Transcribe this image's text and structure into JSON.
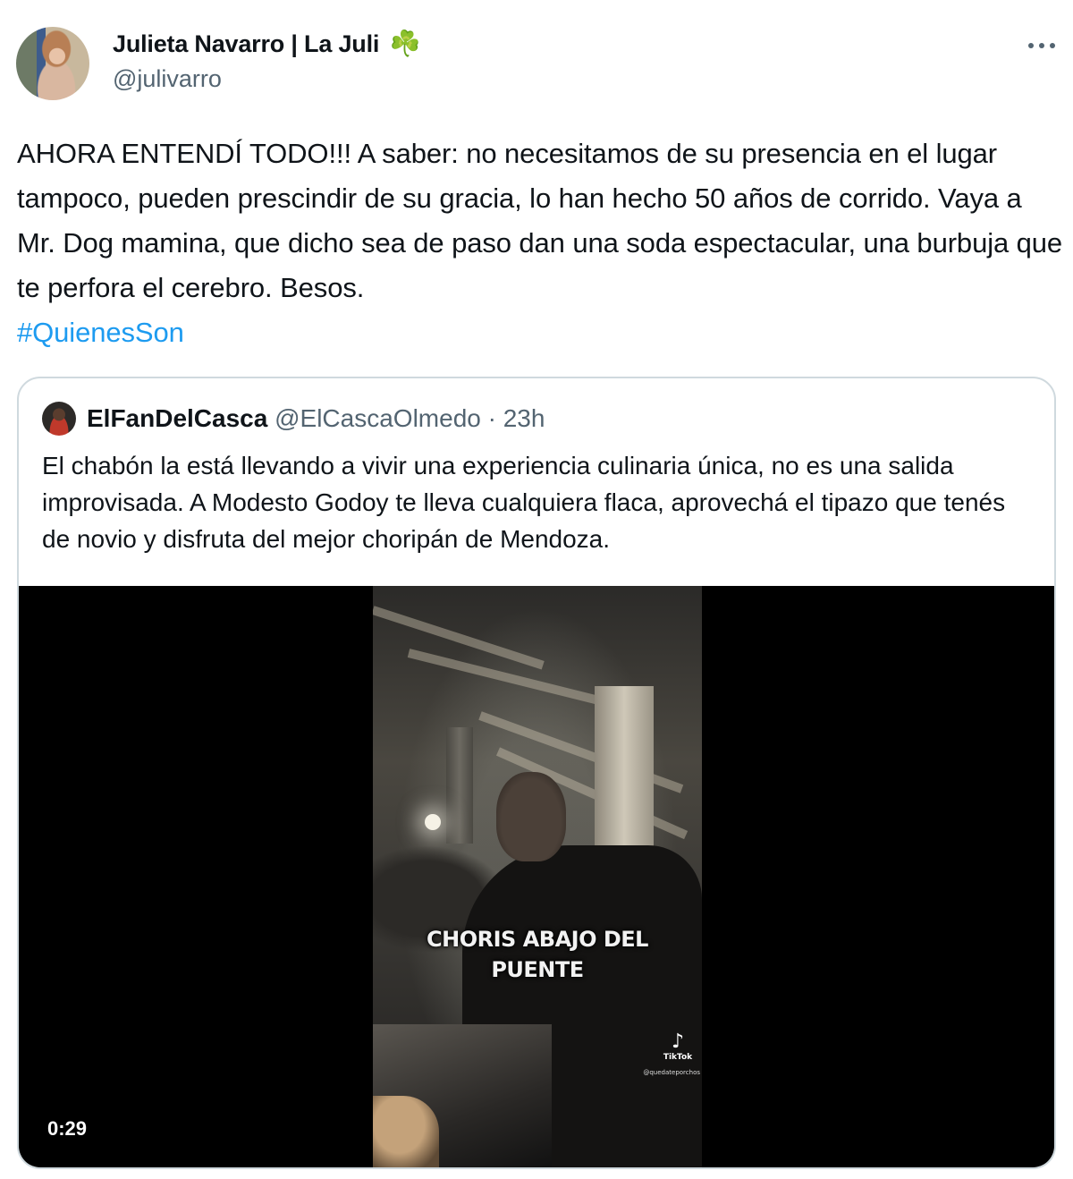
{
  "author": {
    "display_name": "Julieta Navarro | La Juli",
    "emoji": "☘️",
    "handle": "@julivarro"
  },
  "menu": {
    "icon": "more-horizontal-icon"
  },
  "tweet": {
    "text": "AHORA ENTENDÍ TODO!!! A saber: no necesitamos de su presencia en el lugar tampoco, pueden prescindir de su gracia, lo han hecho 50 años de corrido. Vaya a Mr. Dog mamina, que dicho sea de paso dan una soda espectacular, una burbuja que te perfora el cerebro. Besos.",
    "hashtag": "#QuienesSon"
  },
  "quote": {
    "display_name": "ElFanDelCasca",
    "handle": "@ElCascaOlmedo",
    "separator": "·",
    "time": "23h",
    "text": "El chabón la está llevando a vivir una experiencia culinaria única, no es una salida improvisada. A Modesto Godoy te lleva cualquiera flaca, aprovechá el tipazo que tenés de novio y disfruta del mejor choripán de Mendoza.",
    "video": {
      "caption_line1": "CHORIS ABAJO DEL",
      "caption_line2": "PUENTE",
      "watermark_brand": "TikTok",
      "watermark_user": "@quedateporchos",
      "duration": "0:29"
    }
  },
  "colors": {
    "text": "#0f1419",
    "secondary": "#536471",
    "link": "#1d9bf0",
    "border": "#cfd9de"
  }
}
